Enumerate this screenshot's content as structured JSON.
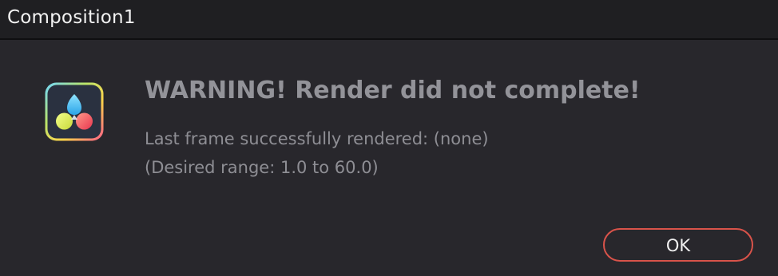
{
  "window": {
    "title": "Composition1"
  },
  "dialog": {
    "icon": "davinci-resolve-logo-icon",
    "heading": "WARNING! Render did not complete!",
    "message_line1": "Last frame successfully rendered: (none)",
    "message_line2": "(Desired range: 1.0 to 60.0)",
    "ok_label": "OK"
  },
  "colors": {
    "background": "#28272c",
    "titlebar": "#1f1f22",
    "button_border": "#d9534a"
  }
}
